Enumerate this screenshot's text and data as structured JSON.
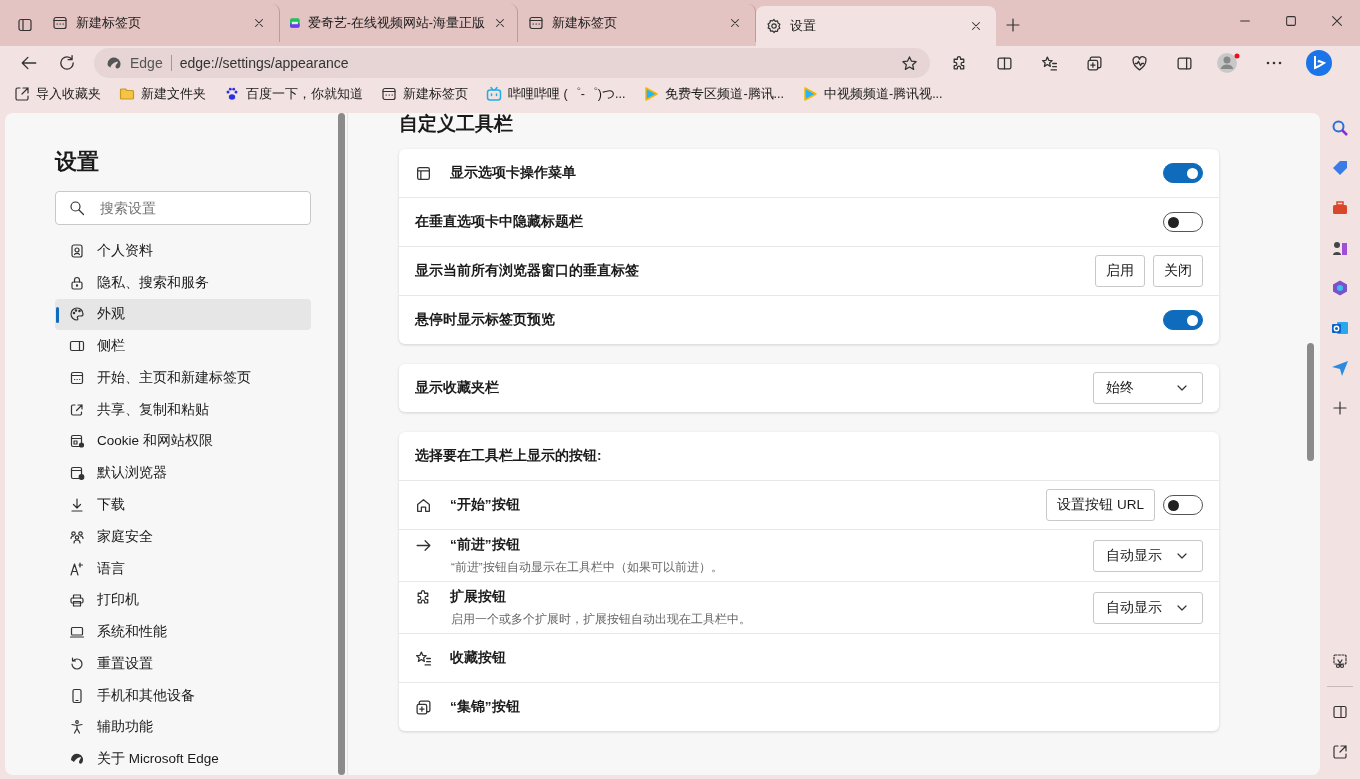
{
  "tabs": [
    {
      "title": "新建标签页",
      "kind": "newtab",
      "selected": false
    },
    {
      "title": "爱奇艺-在线视频网站-海量正版",
      "kind": "video",
      "selected": false
    },
    {
      "title": "新建标签页",
      "kind": "newtab",
      "selected": false
    },
    {
      "title": "设置",
      "kind": "settings",
      "selected": true
    }
  ],
  "address_bar": {
    "site_label": "Edge",
    "url": "edge://settings/appearance"
  },
  "favorites_bar": [
    {
      "label": "导入收藏夹",
      "kind": "import"
    },
    {
      "label": "新建文件夹",
      "kind": "folder"
    },
    {
      "label": "百度一下，你就知道",
      "kind": "paw"
    },
    {
      "label": "新建标签页",
      "kind": "newtab"
    },
    {
      "label": "哔哩哔哩 (゜-゜)つ...",
      "kind": "tv"
    },
    {
      "label": "免费专区频道-腾讯...",
      "kind": "play"
    },
    {
      "label": "中视频频道-腾讯视...",
      "kind": "play"
    }
  ],
  "settings_nav": {
    "title": "设置",
    "search": {
      "placeholder": "搜索设置"
    },
    "items": [
      {
        "label": "个人资料",
        "selected": false
      },
      {
        "label": "隐私、搜索和服务",
        "selected": false
      },
      {
        "label": "外观",
        "selected": true
      },
      {
        "label": "侧栏",
        "selected": false
      },
      {
        "label": "开始、主页和新建标签页",
        "selected": false
      },
      {
        "label": "共享、复制和粘贴",
        "selected": false
      },
      {
        "label": "Cookie 和网站权限",
        "selected": false
      },
      {
        "label": "默认浏览器",
        "selected": false
      },
      {
        "label": "下载",
        "selected": false
      },
      {
        "label": "家庭安全",
        "selected": false
      },
      {
        "label": "语言",
        "selected": false
      },
      {
        "label": "打印机",
        "selected": false
      },
      {
        "label": "系统和性能",
        "selected": false
      },
      {
        "label": "重置设置",
        "selected": false
      },
      {
        "label": "手机和其他设备",
        "selected": false
      },
      {
        "label": "辅助功能",
        "selected": false
      },
      {
        "label": "关于 Microsoft Edge",
        "selected": false
      }
    ]
  },
  "section_title": "自定义工具栏",
  "cards": [
    {
      "rows": [
        {
          "kind": "toggle",
          "label": "显示选项卡操作菜单",
          "on": true
        },
        {
          "kind": "toggle",
          "label": "在垂直选项卡中隐藏标题栏",
          "on": false
        },
        {
          "kind": "buttons",
          "label": "显示当前所有浏览器窗口的垂直标签",
          "buttons": [
            "启用",
            "关闭"
          ]
        },
        {
          "kind": "toggle",
          "label": "悬停时显示标签页预览",
          "on": true
        }
      ]
    },
    {
      "rows": [
        {
          "kind": "dropdown",
          "label": "显示收藏夹栏",
          "value": "始终"
        }
      ]
    },
    {
      "rows": [
        {
          "kind": "heading",
          "label": "选择要在工具栏上显示的按钮:"
        },
        {
          "kind": "toggle",
          "label": "“开始”按钮",
          "on": false,
          "button": "设置按钮 URL"
        },
        {
          "kind": "dropdown",
          "label": "“前进”按钮",
          "value": "自动显示",
          "description": "“前进”按钮自动显示在工具栏中（如果可以前进）。"
        },
        {
          "kind": "dropdown",
          "label": "扩展按钮",
          "value": "自动显示",
          "description": "启用一个或多个扩展时，扩展按钮自动出现在工具栏中。"
        },
        {
          "kind": "plain",
          "label": "收藏按钮"
        },
        {
          "kind": "plain",
          "label": "“集锦”按钮"
        }
      ]
    }
  ]
}
